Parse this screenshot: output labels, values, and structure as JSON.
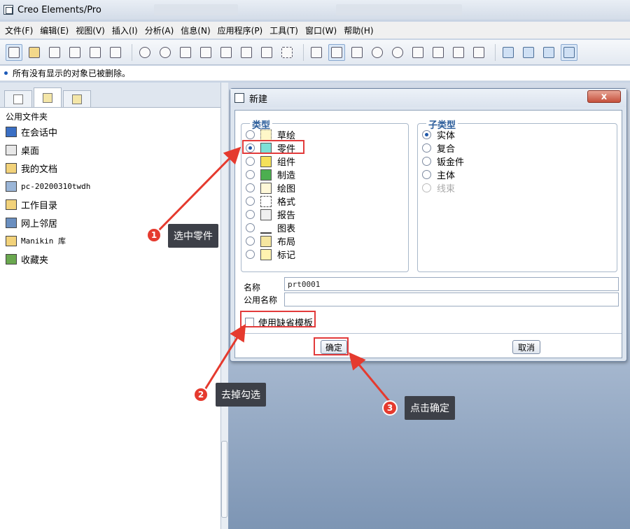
{
  "window": {
    "title": "Creo Elements/Pro"
  },
  "menu": [
    "文件(F)",
    "编辑(E)",
    "视图(V)",
    "插入(I)",
    "分析(A)",
    "信息(N)",
    "应用程序(P)",
    "工具(T)",
    "窗口(W)",
    "帮助(H)"
  ],
  "status_message": "所有没有显示的对象已被删除。",
  "navigator": {
    "header": "公用文件夹",
    "items": [
      {
        "label": "在会话中",
        "icon": "monitor-icon"
      },
      {
        "label": "桌面",
        "icon": "desktop-icon"
      },
      {
        "label": "我的文档",
        "icon": "folder-open-icon"
      },
      {
        "label": "pc-20200310twdh",
        "icon": "computer-icon"
      },
      {
        "label": "工作目录",
        "icon": "folder-star-icon"
      },
      {
        "label": "网上邻居",
        "icon": "network-icon"
      },
      {
        "label": "Manikin 库",
        "icon": "library-icon"
      },
      {
        "label": "收藏夹",
        "icon": "favorites-icon"
      }
    ]
  },
  "dialog": {
    "title": "新建",
    "close_label": "x",
    "type_group": {
      "title": "类型",
      "items": [
        {
          "label": "草绘",
          "selected": false
        },
        {
          "label": "零件",
          "selected": true
        },
        {
          "label": "组件",
          "selected": false
        },
        {
          "label": "制造",
          "selected": false
        },
        {
          "label": "绘图",
          "selected": false
        },
        {
          "label": "格式",
          "selected": false
        },
        {
          "label": "报告",
          "selected": false
        },
        {
          "label": "图表",
          "selected": false
        },
        {
          "label": "布局",
          "selected": false
        },
        {
          "label": "标记",
          "selected": false
        }
      ]
    },
    "subtype_group": {
      "title": "子类型",
      "items": [
        {
          "label": "实体",
          "selected": true,
          "enabled": true
        },
        {
          "label": "复合",
          "selected": false,
          "enabled": true
        },
        {
          "label": "钣金件",
          "selected": false,
          "enabled": true
        },
        {
          "label": "主体",
          "selected": false,
          "enabled": true
        },
        {
          "label": "线束",
          "selected": false,
          "enabled": false
        }
      ]
    },
    "name_label": "名称",
    "name_value": "prt0001",
    "common_name_label": "公用名称",
    "common_name_value": "",
    "use_default_template_label": "使用缺省模板",
    "use_default_template_checked": false,
    "ok_label": "确定",
    "cancel_label": "取消"
  },
  "annotations": [
    {
      "number": "1",
      "text": "选中零件"
    },
    {
      "number": "2",
      "text": "去掉勾选"
    },
    {
      "number": "3",
      "text": "点击确定"
    }
  ],
  "colors": {
    "annotation_red": "#e53a2e",
    "callout_bg": "#3d4048",
    "group_title": "#2a5c9a"
  }
}
